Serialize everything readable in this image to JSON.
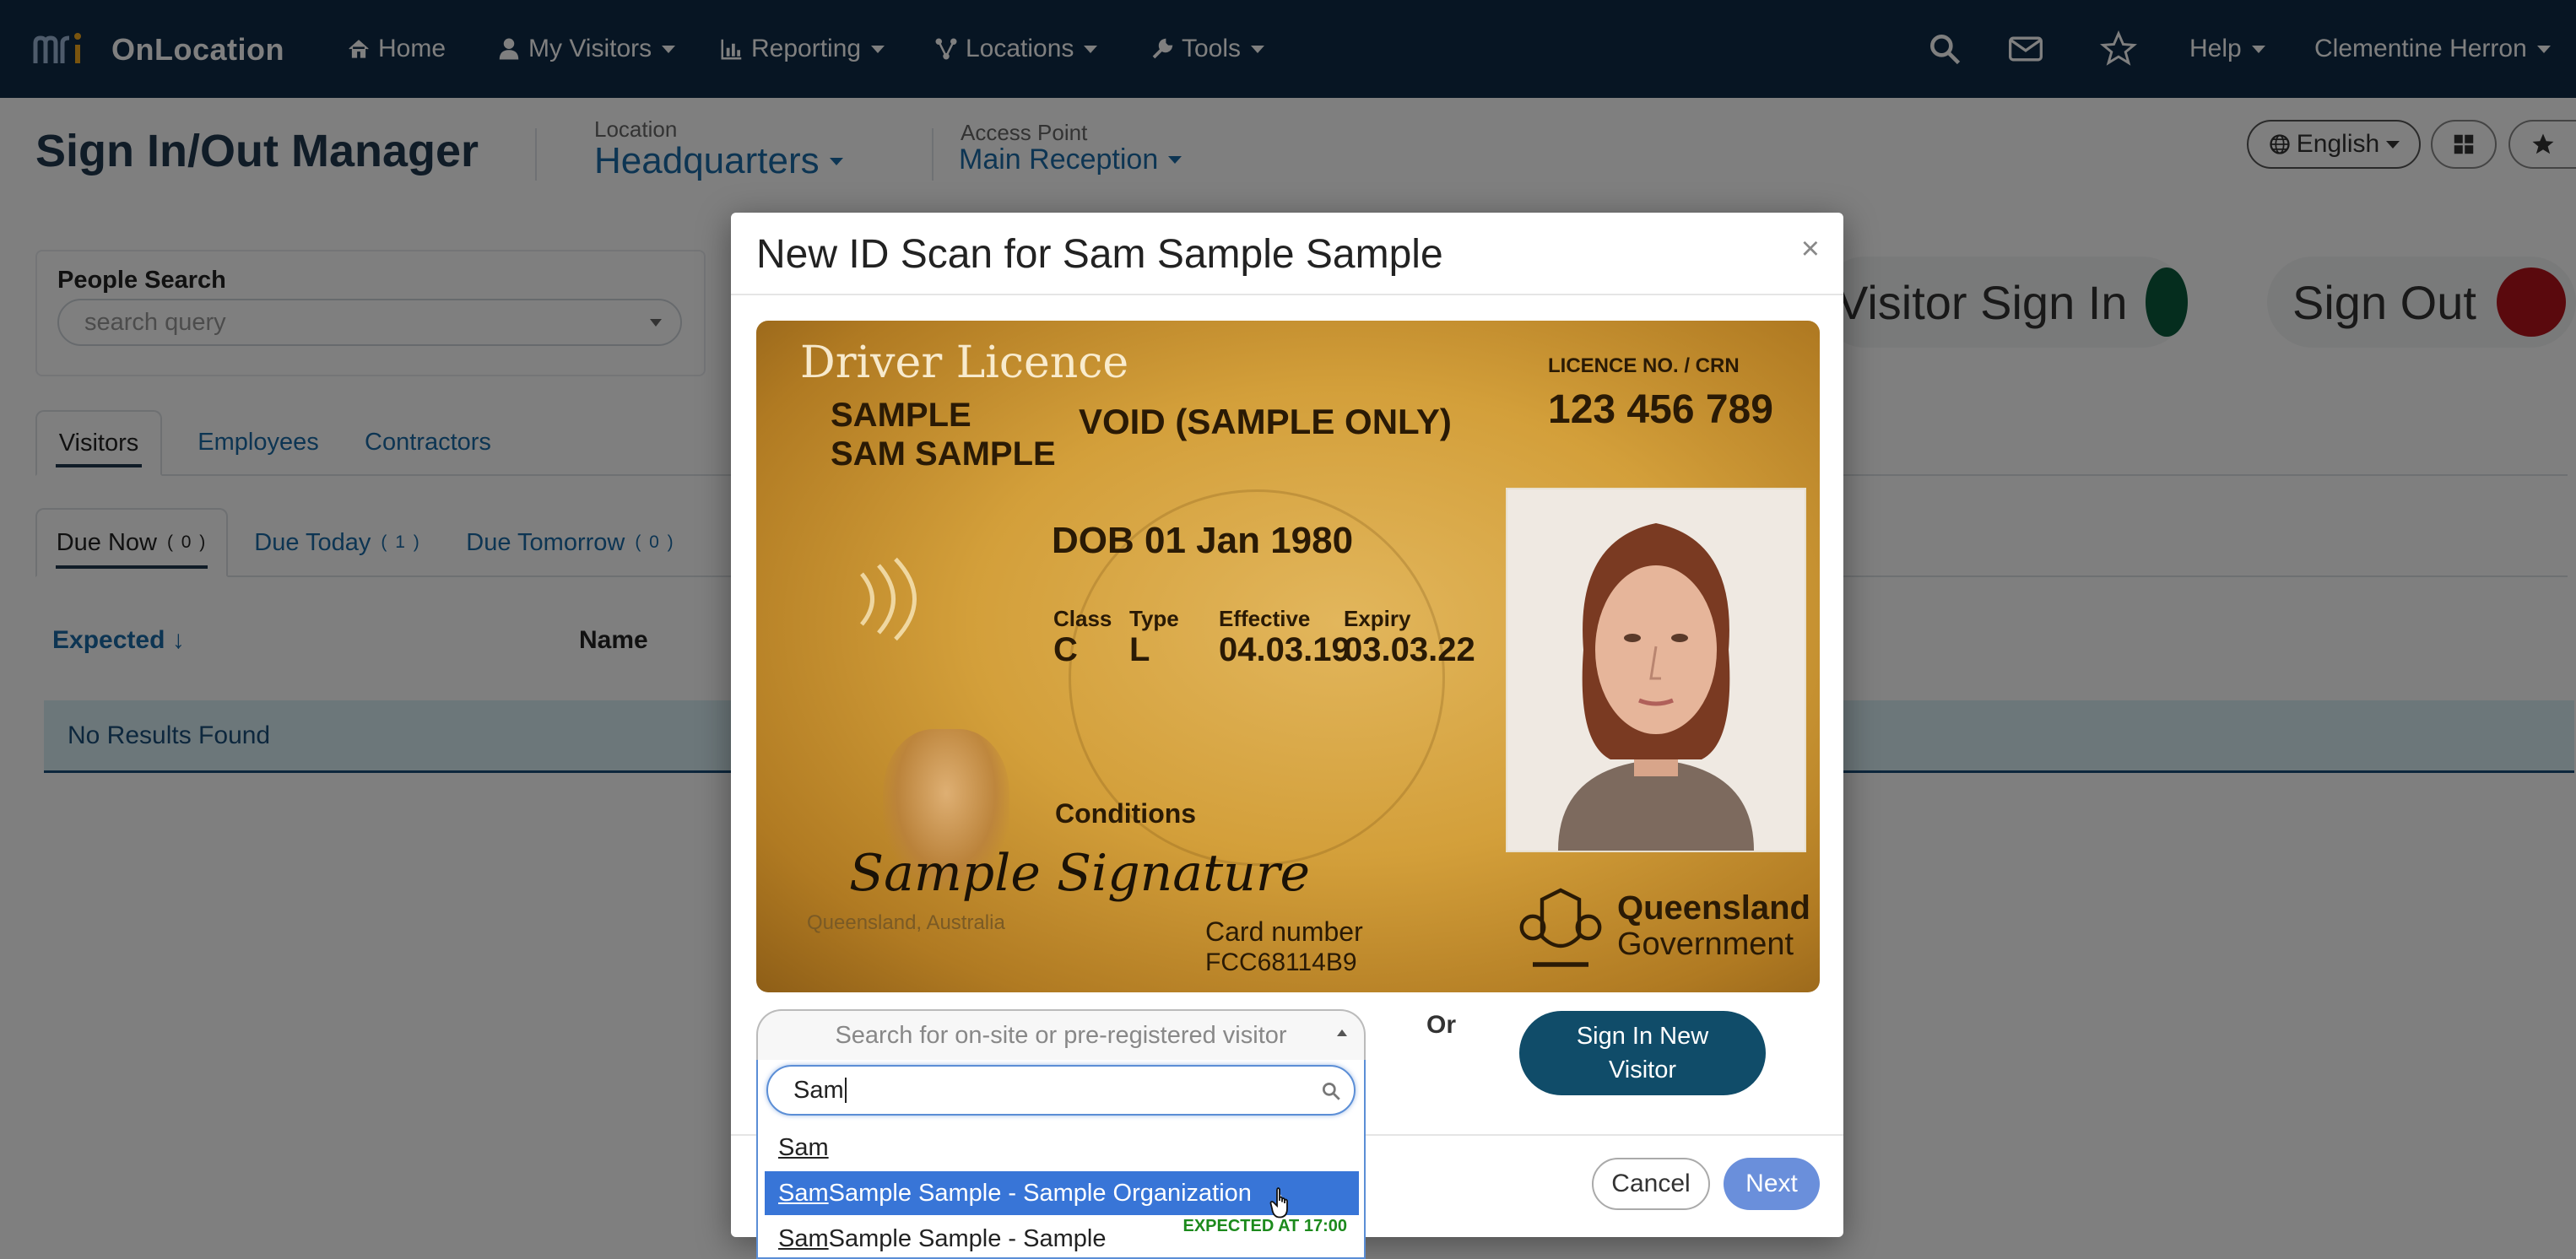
{
  "nav": {
    "brand": "OnLocation",
    "items": [
      {
        "label": "Home",
        "icon": "home-icon",
        "has_caret": false
      },
      {
        "label": "My Visitors",
        "icon": "user-icon",
        "has_caret": true
      },
      {
        "label": "Reporting",
        "icon": "chart-icon",
        "has_caret": true
      },
      {
        "label": "Locations",
        "icon": "network-icon",
        "has_caret": true
      },
      {
        "label": "Tools",
        "icon": "wrench-icon",
        "has_caret": true
      }
    ],
    "help": "Help",
    "user": "Clementine Herron"
  },
  "header": {
    "title": "Sign In/Out Manager",
    "location_label": "Location",
    "location_value": "Headquarters",
    "access_label": "Access Point",
    "access_value": "Main Reception",
    "language": "English"
  },
  "people_search": {
    "label": "People Search",
    "placeholder": "search query"
  },
  "actions": {
    "sign_in": "Visitor Sign In",
    "sign_out": "Sign Out",
    "sign_in_color": "#0b5a3c",
    "sign_out_color": "#b5121b"
  },
  "tabs": [
    "Visitors",
    "Employees",
    "Contractors"
  ],
  "subtabs": [
    {
      "label": "Due Now",
      "count": "( 0 )"
    },
    {
      "label": "Due Today",
      "count": "( 1 )"
    },
    {
      "label": "Due Tomorrow",
      "count": "( 0 )"
    }
  ],
  "table": {
    "col_expected": "Expected ↓",
    "col_name": "Name",
    "empty": "No Results Found"
  },
  "modal": {
    "title": "New ID Scan for Sam Sample Sample",
    "close": "×",
    "card": {
      "title": "Driver Licence",
      "surname": "SAMPLE",
      "given": "SAM SAMPLE",
      "void": "VOID (SAMPLE ONLY)",
      "licence_label": "LICENCE NO. / CRN",
      "licence_no": "123 456 789",
      "dob": "DOB 01 Jan 1980",
      "class_label": "Class",
      "class_val": "C",
      "type_label": "Type",
      "type_val": "L",
      "effective_label": "Effective",
      "effective_val": "04.03.19",
      "expiry_label": "Expiry",
      "expiry_val": "03.03.22",
      "conditions": "Conditions",
      "signature": "Sample Signature",
      "issuer_small": "Queensland, Australia",
      "card_number_label": "Card number",
      "card_number": "FCC68114B9",
      "gov1": "Queensland",
      "gov2": "Government"
    },
    "visitor_search_placeholder": "Search for on-site or pre-registered visitor",
    "or": "Or",
    "new_visitor": "Sign In New Visitor",
    "cancel": "Cancel",
    "next": "Next"
  },
  "dropdown": {
    "query": "Sam",
    "options": [
      {
        "match": "Sam",
        "rest": "",
        "tag": "",
        "highlighted": false
      },
      {
        "match": "Sam",
        "rest": " Sample Sample - Sample Organization",
        "tag": "",
        "highlighted": true
      },
      {
        "match": "Sam",
        "rest": " Sample Sample - Sample",
        "tag": "EXPECTED AT 17:00",
        "highlighted": false
      }
    ]
  }
}
